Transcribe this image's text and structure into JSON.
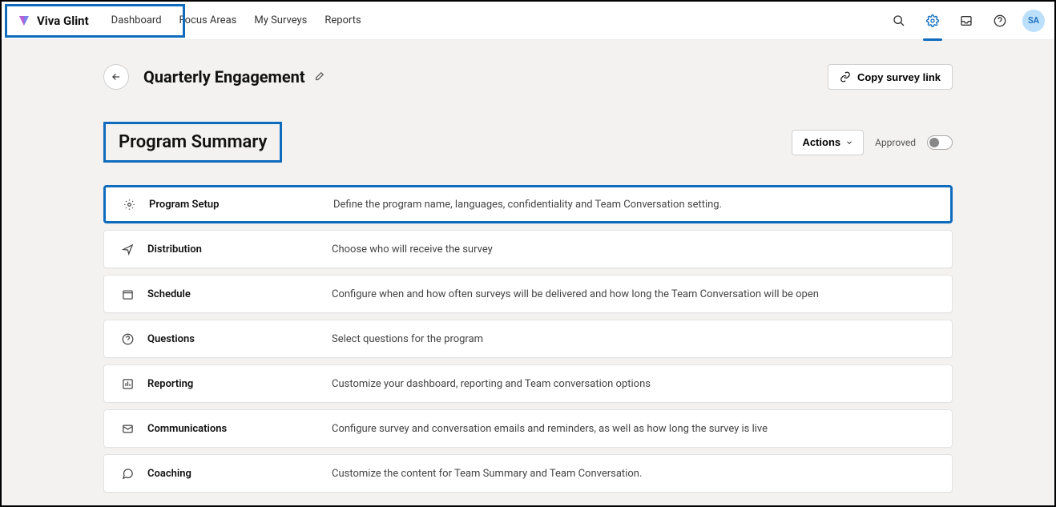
{
  "brand": {
    "name": "Viva Glint"
  },
  "nav": {
    "links": [
      "Dashboard",
      "Focus Areas",
      "My Surveys",
      "Reports"
    ]
  },
  "avatar": {
    "initials": "SA"
  },
  "header": {
    "title": "Quarterly Engagement",
    "copy_button": "Copy survey link"
  },
  "section": {
    "title": "Program Summary",
    "actions_label": "Actions",
    "approved_label": "Approved"
  },
  "items": [
    {
      "label": "Program Setup",
      "desc": "Define the program name, languages, confidentiality and Team Conversation setting."
    },
    {
      "label": "Distribution",
      "desc": "Choose who will receive the survey"
    },
    {
      "label": "Schedule",
      "desc": "Configure when and how often surveys will be delivered and how long the Team Conversation will be open"
    },
    {
      "label": "Questions",
      "desc": "Select questions for the program"
    },
    {
      "label": "Reporting",
      "desc": "Customize your dashboard, reporting and Team conversation options"
    },
    {
      "label": "Communications",
      "desc": "Configure survey and conversation emails and reminders, as well as how long the survey is live"
    },
    {
      "label": "Coaching",
      "desc": "Customize the content for Team Summary and Team Conversation."
    }
  ]
}
